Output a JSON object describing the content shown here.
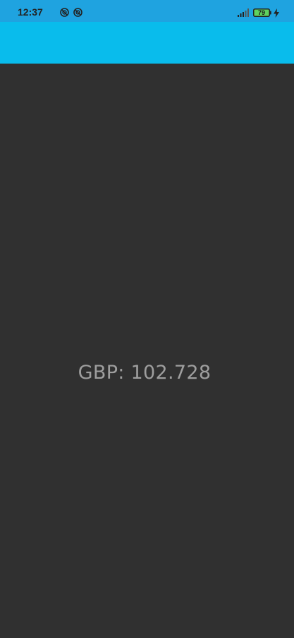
{
  "status_bar": {
    "time": "12:37",
    "battery_level": "79",
    "icons": [
      "notification-circle-icon",
      "notification-circle-icon",
      "signal-icon",
      "battery-icon",
      "charging-bolt-icon"
    ]
  },
  "app_bar": {
    "color": "#09bcec"
  },
  "main": {
    "rate_text": "GBP: 102.728",
    "background": "#303030",
    "text_color": "#9e9e9e"
  }
}
